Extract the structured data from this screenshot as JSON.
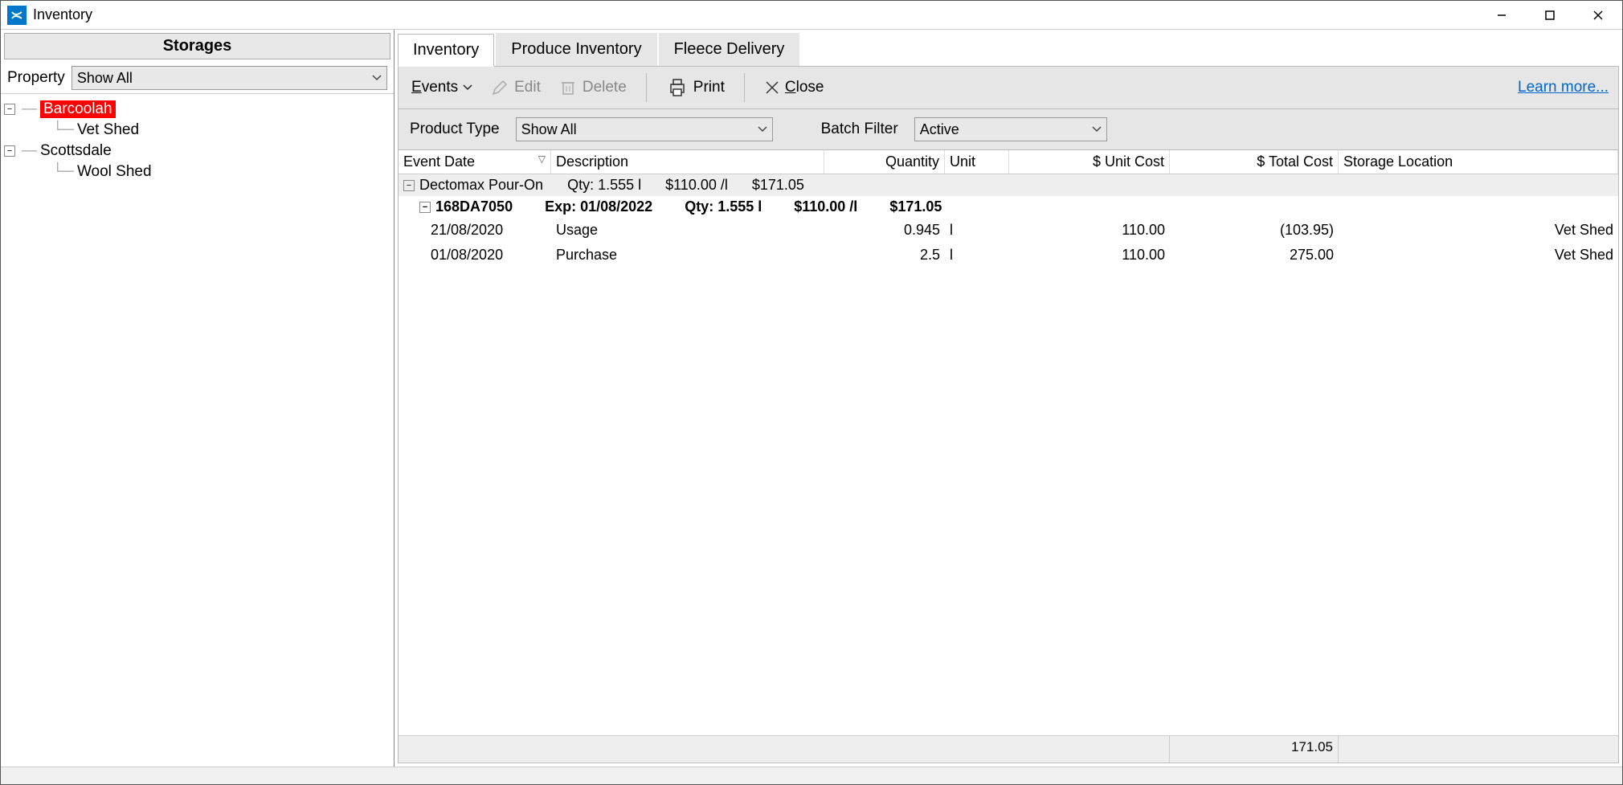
{
  "window": {
    "title": "Inventory"
  },
  "sidebar": {
    "header": "Storages",
    "property_label": "Property",
    "property_value": "Show All",
    "tree": {
      "nodes": [
        {
          "label": "Barcoolah",
          "expanded": true,
          "selected": true,
          "children": [
            {
              "label": "Vet Shed"
            }
          ]
        },
        {
          "label": "Scottsdale",
          "expanded": true,
          "children": [
            {
              "label": "Wool Shed"
            }
          ]
        }
      ]
    }
  },
  "tabs": [
    {
      "label": "Inventory",
      "active": true
    },
    {
      "label": "Produce Inventory"
    },
    {
      "label": "Fleece Delivery"
    }
  ],
  "toolbar": {
    "events_label": "Events",
    "edit_label": "Edit",
    "delete_label": "Delete",
    "print_label": "Print",
    "close_label": "Close",
    "learn_more": "Learn more..."
  },
  "filters": {
    "product_type_label": "Product Type",
    "product_type_value": "Show All",
    "batch_filter_label": "Batch Filter",
    "batch_filter_value": "Active"
  },
  "grid": {
    "columns": {
      "event_date": "Event Date",
      "description": "Description",
      "quantity": "Quantity",
      "unit": "Unit",
      "unit_cost": "$ Unit Cost",
      "total_cost": "$ Total Cost",
      "storage": "Storage Location"
    },
    "product_group": {
      "name": "Dectomax Pour-On",
      "qty_label": "Qty: 1.555 l",
      "unit_cost": "$110.00 /l",
      "total": "$171.05"
    },
    "batch": {
      "code": "168DA7050",
      "exp_label": "Exp: 01/08/2022",
      "qty_label": "Qty: 1.555 l",
      "unit_cost": "$110.00 /l",
      "total": "$171.05"
    },
    "rows": [
      {
        "date": "21/08/2020",
        "desc": "Usage",
        "qty": "0.945",
        "unit": "l",
        "unit_cost": "110.00",
        "total_cost": "(103.95)",
        "storage": "Vet Shed"
      },
      {
        "date": "01/08/2020",
        "desc": "Purchase",
        "qty": "2.5",
        "unit": "l",
        "unit_cost": "110.00",
        "total_cost": "275.00",
        "storage": "Vet Shed"
      }
    ],
    "footer_total": "171.05"
  }
}
